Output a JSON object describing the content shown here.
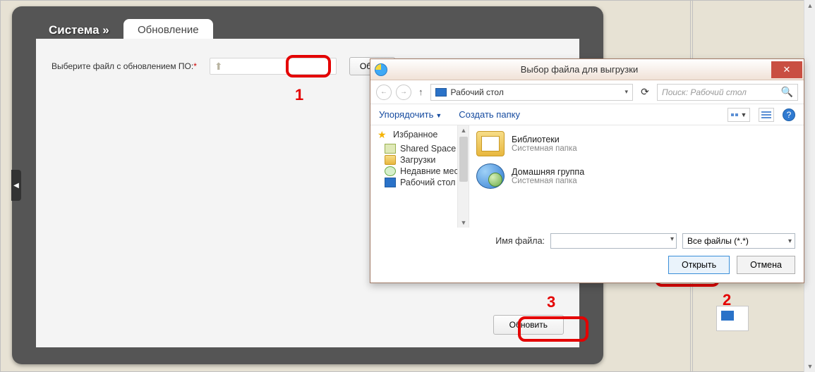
{
  "panel": {
    "breadcrumb": "Система »",
    "tab": "Обновление",
    "field_label": "Выберите файл с обновлением ПО:",
    "required_mark": "*",
    "browse": "Обзор",
    "update": "Обновить"
  },
  "annotations": {
    "n1": "1",
    "n2": "2",
    "n3": "3"
  },
  "dialog": {
    "title": "Выбор файла для выгрузки",
    "path": "Рабочий стол",
    "search_placeholder": "Поиск: Рабочий стол",
    "organize": "Упорядочить",
    "new_folder": "Создать папку",
    "tree": {
      "favorites": "Избранное",
      "items": [
        {
          "label": "Shared Space"
        },
        {
          "label": "Загрузки"
        },
        {
          "label": "Недавние места"
        },
        {
          "label": "Рабочий стол"
        }
      ]
    },
    "content": [
      {
        "name": "Библиотеки",
        "sub": "Системная папка",
        "kind": "lib"
      },
      {
        "name": "Домашняя группа",
        "sub": "Системная папка",
        "kind": "hg"
      }
    ],
    "filename_label": "Имя файла:",
    "filetype": "Все файлы (*.*)",
    "open": "Открыть",
    "cancel": "Отмена"
  }
}
